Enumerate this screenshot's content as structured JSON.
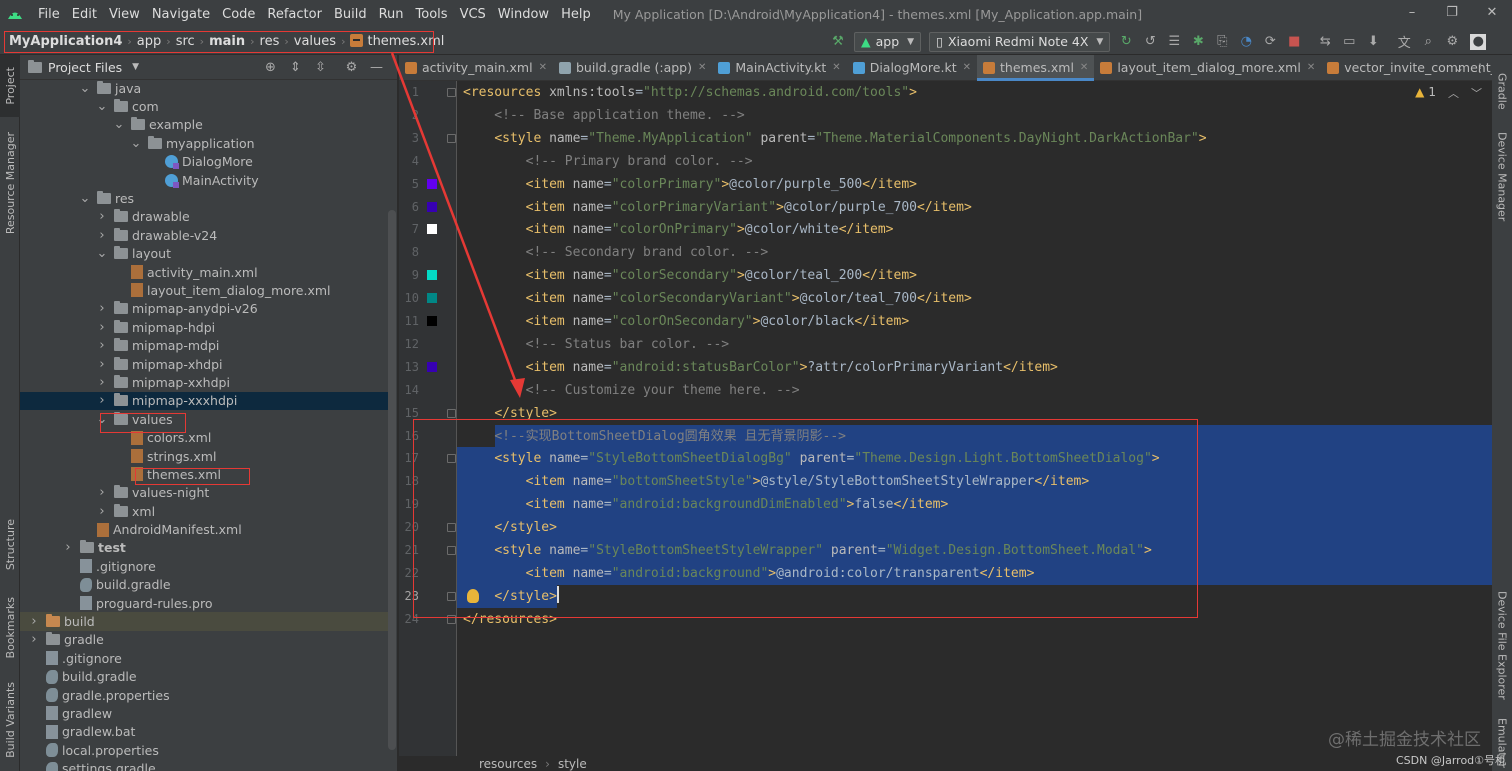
{
  "menubar": {
    "items": [
      "File",
      "Edit",
      "View",
      "Navigate",
      "Code",
      "Refactor",
      "Build",
      "Run",
      "Tools",
      "VCS",
      "Window",
      "Help"
    ],
    "window_title": "My Application [D:\\Android\\MyApplication4] - themes.xml [My_Application.app.main]"
  },
  "breadcrumb": [
    "MyApplication4",
    "app",
    "src",
    "main",
    "res",
    "values",
    "themes.xml"
  ],
  "toolbar": {
    "run_config": "app",
    "device": "Xiaomi Redmi Note 4X"
  },
  "project_panel": {
    "title": "Project Files",
    "tree": [
      {
        "label": "java",
        "depth": 4,
        "kind": "folder",
        "expanded": true
      },
      {
        "label": "com",
        "depth": 5,
        "kind": "folder",
        "expanded": true
      },
      {
        "label": "example",
        "depth": 6,
        "kind": "folder",
        "expanded": true
      },
      {
        "label": "myapplication",
        "depth": 7,
        "kind": "folder",
        "expanded": true
      },
      {
        "label": "DialogMore",
        "depth": 8,
        "kind": "kotlin"
      },
      {
        "label": "MainActivity",
        "depth": 8,
        "kind": "kotlin"
      },
      {
        "label": "res",
        "depth": 4,
        "kind": "folder",
        "expanded": true
      },
      {
        "label": "drawable",
        "depth": 5,
        "kind": "folder",
        "expanded": false
      },
      {
        "label": "drawable-v24",
        "depth": 5,
        "kind": "folder",
        "expanded": false
      },
      {
        "label": "layout",
        "depth": 5,
        "kind": "folder",
        "expanded": true
      },
      {
        "label": "activity_main.xml",
        "depth": 6,
        "kind": "xml"
      },
      {
        "label": "layout_item_dialog_more.xml",
        "depth": 6,
        "kind": "xml"
      },
      {
        "label": "mipmap-anydpi-v26",
        "depth": 5,
        "kind": "folder",
        "expanded": false
      },
      {
        "label": "mipmap-hdpi",
        "depth": 5,
        "kind": "folder",
        "expanded": false
      },
      {
        "label": "mipmap-mdpi",
        "depth": 5,
        "kind": "folder",
        "expanded": false
      },
      {
        "label": "mipmap-xhdpi",
        "depth": 5,
        "kind": "folder",
        "expanded": false
      },
      {
        "label": "mipmap-xxhdpi",
        "depth": 5,
        "kind": "folder",
        "expanded": false
      },
      {
        "label": "mipmap-xxxhdpi",
        "depth": 5,
        "kind": "folder",
        "expanded": false,
        "selected": true
      },
      {
        "label": "values",
        "depth": 5,
        "kind": "folder",
        "expanded": true
      },
      {
        "label": "colors.xml",
        "depth": 6,
        "kind": "xml"
      },
      {
        "label": "strings.xml",
        "depth": 6,
        "kind": "xml"
      },
      {
        "label": "themes.xml",
        "depth": 6,
        "kind": "xml"
      },
      {
        "label": "values-night",
        "depth": 5,
        "kind": "folder",
        "expanded": false
      },
      {
        "label": "xml",
        "depth": 5,
        "kind": "folder",
        "expanded": false
      },
      {
        "label": "AndroidManifest.xml",
        "depth": 4,
        "kind": "manifest"
      },
      {
        "label": "test",
        "depth": 3,
        "kind": "folder",
        "expanded": false,
        "bold": true
      },
      {
        "label": ".gitignore",
        "depth": 3,
        "kind": "file"
      },
      {
        "label": "build.gradle",
        "depth": 3,
        "kind": "gradle"
      },
      {
        "label": "proguard-rules.pro",
        "depth": 3,
        "kind": "file"
      },
      {
        "label": "build",
        "depth": 1,
        "kind": "folder-orange",
        "expanded": false,
        "highlight": true
      },
      {
        "label": "gradle",
        "depth": 1,
        "kind": "folder",
        "expanded": false
      },
      {
        "label": ".gitignore",
        "depth": 1,
        "kind": "file"
      },
      {
        "label": "build.gradle",
        "depth": 1,
        "kind": "gradle"
      },
      {
        "label": "gradle.properties",
        "depth": 1,
        "kind": "gradle"
      },
      {
        "label": "gradlew",
        "depth": 1,
        "kind": "file"
      },
      {
        "label": "gradlew.bat",
        "depth": 1,
        "kind": "file"
      },
      {
        "label": "local.properties",
        "depth": 1,
        "kind": "gradle"
      },
      {
        "label": "settings.gradle",
        "depth": 1,
        "kind": "gradle"
      }
    ]
  },
  "side_tabs": {
    "left": [
      "Project",
      "Resource Manager",
      "Structure",
      "Bookmarks",
      "Build Variants"
    ],
    "right": [
      "Gradle",
      "Device Manager",
      "Device File Explorer",
      "Emulator"
    ]
  },
  "editor_tabs": [
    {
      "label": "activity_main.xml",
      "color": "#c77c3a"
    },
    {
      "label": "build.gradle (:app)",
      "color": "#8fa3ad"
    },
    {
      "label": "MainActivity.kt",
      "color": "#4f9fd6"
    },
    {
      "label": "DialogMore.kt",
      "color": "#4f9fd6"
    },
    {
      "label": "themes.xml",
      "color": "#c77c3a",
      "active": true
    },
    {
      "label": "layout_item_dialog_more.xml",
      "color": "#c77c3a"
    },
    {
      "label": "vector_invite_comment_close.x",
      "color": "#c77c3a"
    }
  ],
  "inspection": {
    "warnings": "1"
  },
  "code_lines": [
    {
      "n": "1",
      "tokens": [
        [
          "t",
          "<resources "
        ],
        [
          "a",
          "xmlns:tools"
        ],
        [
          "x",
          "="
        ],
        [
          "v",
          "\"http://schemas.android.com/tools\""
        ],
        [
          "t",
          ">"
        ]
      ]
    },
    {
      "n": "2",
      "tokens": [
        [
          "c",
          "    <!-- Base application theme. -->"
        ]
      ]
    },
    {
      "n": "3",
      "tokens": [
        [
          "x",
          "    "
        ],
        [
          "t",
          "<style "
        ],
        [
          "a",
          "name"
        ],
        [
          "x",
          "="
        ],
        [
          "v",
          "\"Theme.MyApplication\""
        ],
        [
          "x",
          " "
        ],
        [
          "a",
          "parent"
        ],
        [
          "x",
          "="
        ],
        [
          "v",
          "\"Theme.MaterialComponents.DayNight.DarkActionBar\""
        ],
        [
          "t",
          ">"
        ]
      ]
    },
    {
      "n": "4",
      "tokens": [
        [
          "c",
          "        <!-- Primary brand color. -->"
        ]
      ]
    },
    {
      "n": "5",
      "swatch": "#6200ee",
      "tokens": [
        [
          "x",
          "        "
        ],
        [
          "t",
          "<item "
        ],
        [
          "a",
          "name"
        ],
        [
          "x",
          "="
        ],
        [
          "v",
          "\"colorPrimary\""
        ],
        [
          "t",
          ">"
        ],
        [
          "x",
          "@color/purple_500"
        ],
        [
          "t",
          "</item>"
        ]
      ]
    },
    {
      "n": "6",
      "swatch": "#3700b3",
      "tokens": [
        [
          "x",
          "        "
        ],
        [
          "t",
          "<item "
        ],
        [
          "a",
          "name"
        ],
        [
          "x",
          "="
        ],
        [
          "v",
          "\"colorPrimaryVariant\""
        ],
        [
          "t",
          ">"
        ],
        [
          "x",
          "@color/purple_700"
        ],
        [
          "t",
          "</item>"
        ]
      ]
    },
    {
      "n": "7",
      "swatch": "#ffffff",
      "tokens": [
        [
          "x",
          "        "
        ],
        [
          "t",
          "<item "
        ],
        [
          "a",
          "name"
        ],
        [
          "x",
          "="
        ],
        [
          "v",
          "\"colorOnPrimary\""
        ],
        [
          "t",
          ">"
        ],
        [
          "x",
          "@color/white"
        ],
        [
          "t",
          "</item>"
        ]
      ]
    },
    {
      "n": "8",
      "tokens": [
        [
          "c",
          "        <!-- Secondary brand color. -->"
        ]
      ]
    },
    {
      "n": "9",
      "swatch": "#03dac5",
      "tokens": [
        [
          "x",
          "        "
        ],
        [
          "t",
          "<item "
        ],
        [
          "a",
          "name"
        ],
        [
          "x",
          "="
        ],
        [
          "v",
          "\"colorSecondary\""
        ],
        [
          "t",
          ">"
        ],
        [
          "x",
          "@color/teal_200"
        ],
        [
          "t",
          "</item>"
        ]
      ]
    },
    {
      "n": "10",
      "swatch": "#018786",
      "tokens": [
        [
          "x",
          "        "
        ],
        [
          "t",
          "<item "
        ],
        [
          "a",
          "name"
        ],
        [
          "x",
          "="
        ],
        [
          "v",
          "\"colorSecondaryVariant\""
        ],
        [
          "t",
          ">"
        ],
        [
          "x",
          "@color/teal_700"
        ],
        [
          "t",
          "</item>"
        ]
      ]
    },
    {
      "n": "11",
      "swatch": "#000000",
      "tokens": [
        [
          "x",
          "        "
        ],
        [
          "t",
          "<item "
        ],
        [
          "a",
          "name"
        ],
        [
          "x",
          "="
        ],
        [
          "v",
          "\"colorOnSecondary\""
        ],
        [
          "t",
          ">"
        ],
        [
          "x",
          "@color/black"
        ],
        [
          "t",
          "</item>"
        ]
      ]
    },
    {
      "n": "12",
      "tokens": [
        [
          "c",
          "        <!-- Status bar color. -->"
        ]
      ]
    },
    {
      "n": "13",
      "swatch": "#3700b3",
      "tokens": [
        [
          "x",
          "        "
        ],
        [
          "t",
          "<item "
        ],
        [
          "a",
          "name"
        ],
        [
          "x",
          "="
        ],
        [
          "v",
          "\"android:statusBarColor\""
        ],
        [
          "t",
          ">"
        ],
        [
          "x",
          "?attr/colorPrimaryVariant"
        ],
        [
          "t",
          "</item>"
        ]
      ]
    },
    {
      "n": "14",
      "tokens": [
        [
          "c",
          "        <!-- Customize your theme here. -->"
        ]
      ]
    },
    {
      "n": "15",
      "tokens": [
        [
          "x",
          "    "
        ],
        [
          "t",
          "</style>"
        ]
      ]
    },
    {
      "n": "16",
      "sel": true,
      "tokens": [
        [
          "x",
          "    "
        ],
        [
          "c",
          "<!--实现BottomSheetDialog圆角效果 且无背景阴影-->"
        ]
      ]
    },
    {
      "n": "17",
      "sel": true,
      "tokens": [
        [
          "x",
          "    "
        ],
        [
          "t",
          "<style "
        ],
        [
          "a",
          "name"
        ],
        [
          "x",
          "="
        ],
        [
          "v",
          "\"StyleBottomSheetDialogBg\""
        ],
        [
          "x",
          " "
        ],
        [
          "a",
          "parent"
        ],
        [
          "x",
          "="
        ],
        [
          "v",
          "\"Theme.Design.Light.BottomSheetDialog\""
        ],
        [
          "t",
          ">"
        ]
      ]
    },
    {
      "n": "18",
      "sel": true,
      "tokens": [
        [
          "x",
          "        "
        ],
        [
          "t",
          "<item "
        ],
        [
          "a",
          "name"
        ],
        [
          "x",
          "="
        ],
        [
          "v",
          "\"bottomSheetStyle\""
        ],
        [
          "t",
          ">"
        ],
        [
          "x",
          "@style/StyleBottomSheetStyleWrapper"
        ],
        [
          "t",
          "</item>"
        ]
      ]
    },
    {
      "n": "19",
      "sel": true,
      "tokens": [
        [
          "x",
          "        "
        ],
        [
          "t",
          "<item "
        ],
        [
          "a",
          "name"
        ],
        [
          "x",
          "="
        ],
        [
          "v",
          "\"android:backgroundDimEnabled\""
        ],
        [
          "t",
          ">"
        ],
        [
          "x",
          "false"
        ],
        [
          "t",
          "</item>"
        ]
      ]
    },
    {
      "n": "20",
      "sel": true,
      "tokens": [
        [
          "x",
          "    "
        ],
        [
          "t",
          "</style>"
        ]
      ]
    },
    {
      "n": "21",
      "sel": true,
      "tokens": [
        [
          "x",
          "    "
        ],
        [
          "t",
          "<style "
        ],
        [
          "a",
          "name"
        ],
        [
          "x",
          "="
        ],
        [
          "v",
          "\"StyleBottomSheetStyleWrapper\""
        ],
        [
          "x",
          " "
        ],
        [
          "a",
          "parent"
        ],
        [
          "x",
          "="
        ],
        [
          "v",
          "\"Widget.Design.BottomSheet.Modal\""
        ],
        [
          "t",
          ">"
        ]
      ]
    },
    {
      "n": "22",
      "sel": true,
      "tokens": [
        [
          "x",
          "        "
        ],
        [
          "t",
          "<item "
        ],
        [
          "a",
          "name"
        ],
        [
          "x",
          "="
        ],
        [
          "v",
          "\"android:background\""
        ],
        [
          "t",
          ">"
        ],
        [
          "x",
          "@android:color/transparent"
        ],
        [
          "t",
          "</item>"
        ]
      ]
    },
    {
      "n": "23",
      "sel": true,
      "cur": true,
      "tokens": [
        [
          "x",
          "    "
        ],
        [
          "t",
          "</style>"
        ]
      ]
    },
    {
      "n": "24",
      "tokens": [
        [
          "t",
          "</resources>"
        ]
      ]
    }
  ],
  "status_breadcrumb": [
    "resources",
    "style"
  ],
  "watermark": "@稀土掘金技术社区",
  "csdn_credit": "CSDN @Jarrod①号机",
  "colors": {
    "accent": "#4a88c7",
    "selection": "#214283",
    "annotation_red": "#e53935"
  }
}
